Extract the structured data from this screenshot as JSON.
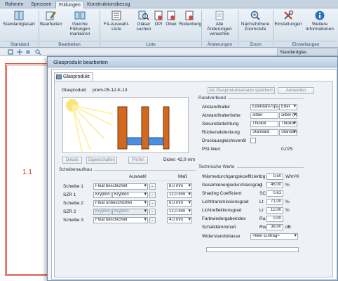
{
  "tabs": [
    "Rahmen",
    "Sprossen",
    "Füllungen",
    "Konstruktionsbezug"
  ],
  "active_tab": "Füllungen",
  "ribbon": {
    "buttons": [
      {
        "label": "Standardglasart",
        "icon": "glass-pane-icon"
      },
      {
        "label": "Bearbeiten",
        "icon": "edit-fill-icon"
      },
      {
        "label": "Gleiche Füllungen markieren",
        "icon": "mark-fills-icon"
      },
      {
        "label": "F4-Auswahl-Liste",
        "icon": "list-icon"
      },
      {
        "label": "Gläser suchen",
        "icon": "search-glass-icon"
      },
      {
        "label": "DPI",
        "icon": "dpi-doc-icon"
      },
      {
        "label": "Obuk",
        "icon": "obuk-doc-icon"
      },
      {
        "label": "Rodenberg",
        "icon": "rodenberg-doc-icon"
      },
      {
        "label": "Alle Änderungen verwerfen",
        "icon": "discard-changes-icon"
      },
      {
        "label": "Nächsthöhere Zoomstufe",
        "icon": "zoom-in-icon"
      },
      {
        "label": "Einstellungen",
        "icon": "settings-tools-icon"
      },
      {
        "label": "Weitere Informationen",
        "icon": "info-icon"
      }
    ],
    "groups": [
      "Standard",
      "Bearbeiten",
      "Liste",
      "Änderungen",
      "Zoom",
      "Einstellungen"
    ]
  },
  "side_panel_header": "Standardglas",
  "canvas_label": "1.1",
  "dialog": {
    "title": "Glasprodukt bearbeiten",
    "tab": "Glasprodukt",
    "product_label": "Glasprodukt",
    "product_value": "prem-05-12-K-13",
    "btn_save_variant": "Als Glasproduktvariante speichern",
    "btn_evaluate": "Auswerten",
    "btn_details": "Details",
    "btn_properties": "Eigenschaften",
    "btn_check": "Prüfen",
    "thickness": "Dicke: 42,0 mm",
    "pane_section": "Scheibenaufbau",
    "col_selection": "Auswahl",
    "col_size": "Maß",
    "rows": [
      {
        "label": "Scheibe 1",
        "sel1": "Float beschichtet",
        "sel2": "",
        "size": "8,0 mm"
      },
      {
        "label": "SZR 1",
        "sel1": "Krypton",
        "sel2": "Krypton",
        "size": "12,0 mm"
      },
      {
        "label": "Scheibe 2",
        "sel1": "Float unbeschichtet",
        "sel2": "",
        "size": "6,0 mm"
      },
      {
        "label": "SZR 2",
        "sel1": "Krypton",
        "sel2": "Krypton",
        "size": "12,0 mm"
      },
      {
        "label": "Scheibe 3",
        "sel1": "Float beschichtet",
        "sel2": "",
        "size": "4,0 mm"
      }
    ],
    "edge_section": "Randverbund",
    "edge_rows": [
      {
        "label": "Abstandhalter",
        "v1": "Edelstahl-Spacer",
        "v2": "Edel"
      },
      {
        "label": "Abstandhalterfarbe",
        "v1": "silber",
        "v2": "silber (Ru"
      },
      {
        "label": "Sekundärdichtung",
        "v1": "Thiokol",
        "v2": "Thiokol"
      },
      {
        "label": "Rückenabdeckung",
        "v1": "Standard",
        "v2": "Standard (R"
      }
    ],
    "pressure_label": "Druckausgleichsventil",
    "psi_label": "PSI-Wert",
    "psi_value": "0,075",
    "tech_section": "Technische Werte",
    "tech_rows": [
      {
        "label": "Wärmedurchgangskoeffizient",
        "sym": "Ug",
        "value": "0,50",
        "unit": "W/m²K"
      },
      {
        "label": "Gesamtenergiedurchlassgrad",
        "sym": "g",
        "value": "46,00",
        "unit": "%"
      },
      {
        "label": "Shading Coefficient",
        "sym": "SC",
        "value": "0,61",
        "unit": ""
      },
      {
        "label": "Lichttransmissionsgrad",
        "sym": "Lt",
        "value": "71,00",
        "unit": "%"
      },
      {
        "label": "Lichtreflektionsgrad",
        "sym": "Lr",
        "value": "15,00",
        "unit": "%"
      },
      {
        "label": "Farbwiedergabeindex",
        "sym": "Ra",
        "value": "0,00",
        "unit": ""
      },
      {
        "label": "Schalldämmmaß",
        "sym": "Rw",
        "value": "36,00",
        "unit": "dB"
      }
    ],
    "resistance_label": "Widerstandsklasse",
    "resistance_value": "<kein Eintrag>"
  },
  "colors": {
    "pane_orange": "#d2691e",
    "gap_blue": "#4a90e2",
    "accent_red": "#d64a3a"
  }
}
